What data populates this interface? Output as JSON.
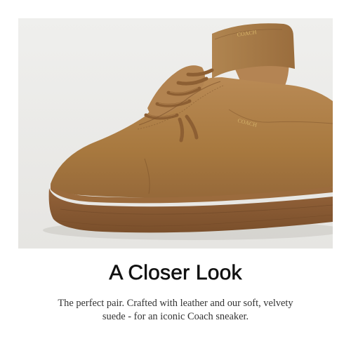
{
  "image": {
    "brand_mark_heel": "COACH",
    "brand_mark_side": "COACH",
    "colors": {
      "background": "#ececea",
      "suede": "#a97b48",
      "sole": "#8e5f34"
    }
  },
  "content": {
    "headline": "A Closer Look",
    "body_line_1": "The perfect pair. Crafted with leather and our soft, velvety",
    "body_line_2": "suede - for an iconic Coach sneaker."
  }
}
